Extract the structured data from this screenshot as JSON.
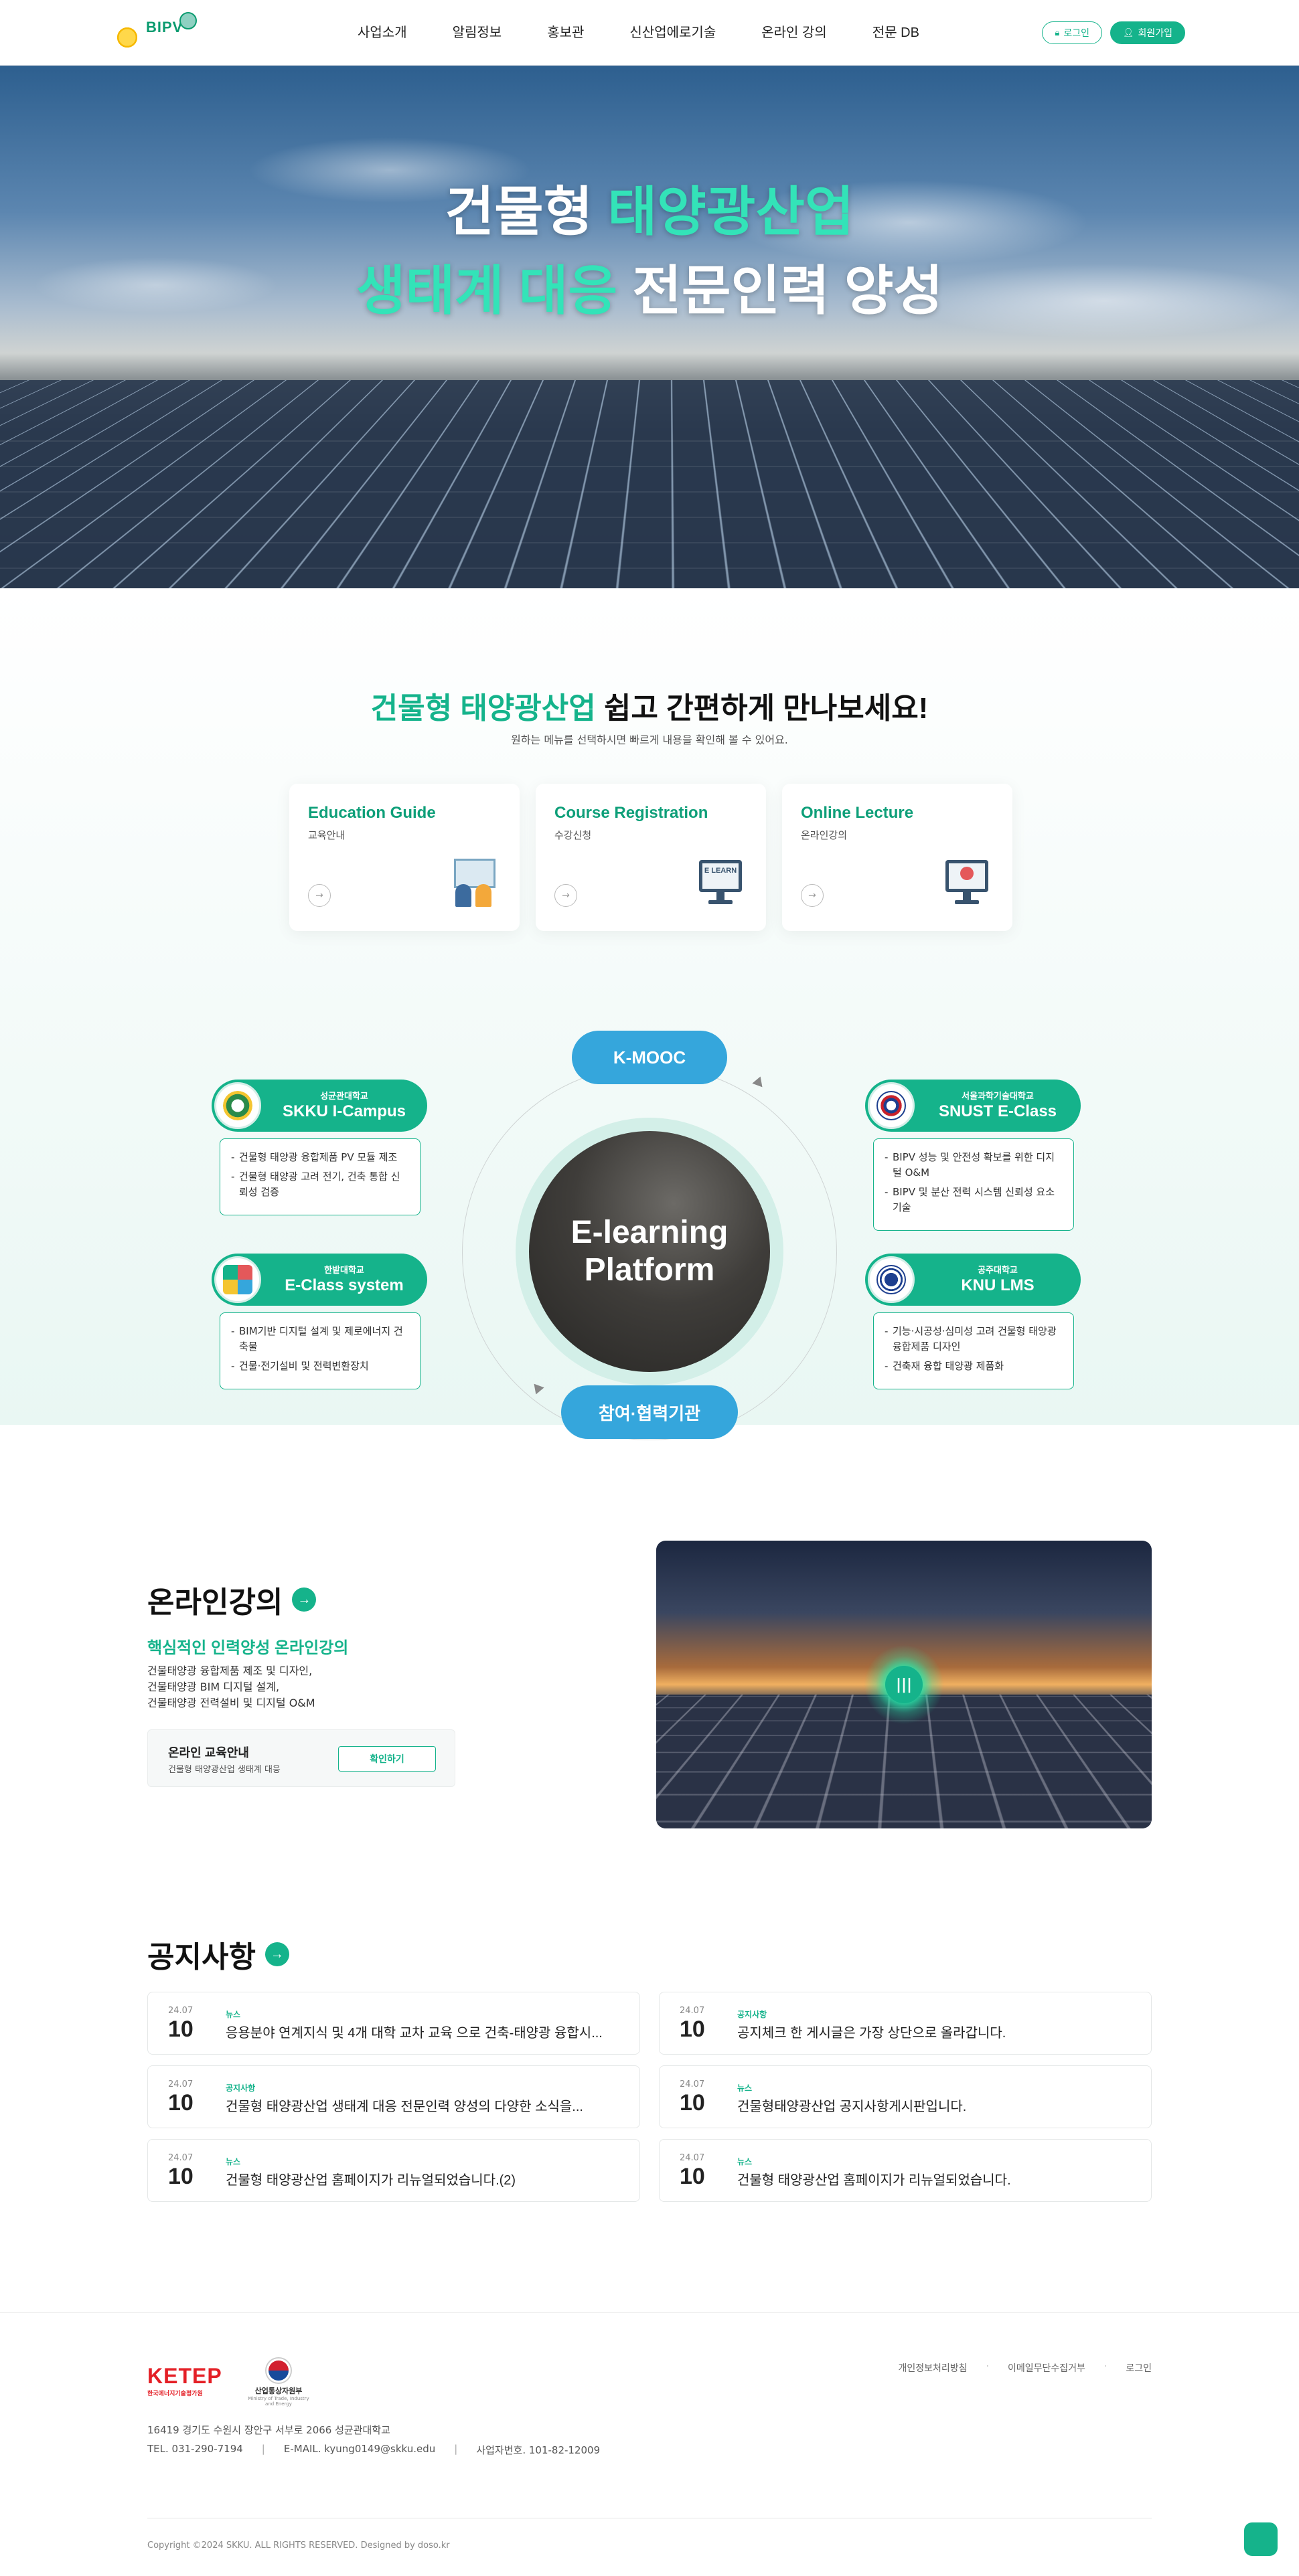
{
  "header": {
    "logo_text": "BIPV",
    "nav": [
      "사업소개",
      "알림정보",
      "홍보관",
      "신산업에로기술",
      "온라인 강의",
      "전문 DB"
    ],
    "login_label": "로그인",
    "signup_label": "회원가입"
  },
  "hero": {
    "line1_a": "건물형 ",
    "line1_b": "태양광산업",
    "line2_a": "생태계 대응",
    "line2_b": " 전문인력 양성"
  },
  "quick": {
    "title_green": "건물형 태양광산업",
    "title_rest": " 쉽고 간편하게 만나보세요!",
    "subtitle": "원하는 메뉴를 선택하시면 빠르게 내용을 확인해 볼 수 있어요.",
    "cards": [
      {
        "title": "Education Guide",
        "sub": "교육안내"
      },
      {
        "title": "Course Registration",
        "sub": "수강신청",
        "screen_text": "E LEARN"
      },
      {
        "title": "Online Lecture",
        "sub": "온라인강의"
      }
    ]
  },
  "diagram": {
    "center": "E-learning Platform",
    "top_tag": "K-MOOC",
    "bottom_tag": "참여·협력기관",
    "unis": [
      {
        "small": "성균관대학교",
        "name": "SKKU I-Campus",
        "items": [
          "건물형 태양광 융합제품 PV 모듈 제조",
          "건물형 태양광 고려 전기, 건축 통합 신뢰성 검증"
        ]
      },
      {
        "small": "한밭대학교",
        "name": "E-Class system",
        "items": [
          "BIM기반 디지털 설계 및 제로에너지 건축물",
          "건물·전기설비 및 전력변환장치"
        ]
      },
      {
        "small": "서울과학기술대학교",
        "name": "SNUST E-Class",
        "items": [
          "BIPV 성능 및 안전성 확보를 위한 디지털 O&M",
          "BIPV 및 분산 전력 시스템 신뢰성 요소기술"
        ]
      },
      {
        "small": "공주대학교",
        "name": "KNU LMS",
        "items": [
          "기능·시공성·심미성 고려 건물형 태양광 융합제품 디자인",
          "건축재 융합 태양광 제품화"
        ]
      }
    ]
  },
  "lecture": {
    "title": "온라인강의",
    "subtitle": "핵심적인 인력양성 온라인강의",
    "desc": [
      "건물태양광 융합제품 제조 및 디자인,",
      "건물태양광 BIM 디지털 설계,",
      "건물태양광 전력설비 및 디지털 O&M"
    ],
    "box_title": "온라인 교육안내",
    "box_sub": "건물형 태양광산업 생태계 대응",
    "box_button": "확인하기"
  },
  "notices": {
    "title": "공지사항",
    "items": [
      {
        "ym": "24.07",
        "day": "10",
        "cat": "뉴스",
        "title": "응용분야 연계지식 및 4개 대학 교차 교육 으로 건축-태양광 융합시..."
      },
      {
        "ym": "24.07",
        "day": "10",
        "cat": "공지사항",
        "title": "공지체크 한 게시글은 가장 상단으로 올라갑니다."
      },
      {
        "ym": "24.07",
        "day": "10",
        "cat": "공지사항",
        "title": "건물형 태양광산업 생태계 대응 전문인력 양성의 다양한 소식을..."
      },
      {
        "ym": "24.07",
        "day": "10",
        "cat": "뉴스",
        "title": "건물형태양광산업 공지사항게시판입니다."
      },
      {
        "ym": "24.07",
        "day": "10",
        "cat": "뉴스",
        "title": "건물형 태양광산업 홈페이지가 리뉴얼되었습니다.(2)"
      },
      {
        "ym": "24.07",
        "day": "10",
        "cat": "뉴스",
        "title": "건물형 태양광산업 홈페이지가 리뉴얼되었습니다."
      }
    ]
  },
  "footer": {
    "ketep": "KETEP",
    "ketep_sub": "한국에너지기술평가원",
    "motie": "산업통상자원부",
    "motie_en": "Ministry of Trade, Industry and Energy",
    "links": [
      "개인정보처리방침",
      "이메일무단수집거부",
      "로그인"
    ],
    "address": "16419 경기도 수원시 장안구 서부로 2066 성균관대학교",
    "tel": "TEL. 031-290-7194",
    "email": "E-MAIL. kyung0149@skku.edu",
    "bizno": "사업자번호. 101-82-12009",
    "copyright": "Copyright ©2024 SKKU. ALL RIGHTS RESERVED. Designed by doso.kr"
  },
  "colors": {
    "accent": "#15b38b",
    "blue_tag": "#35a6dc",
    "hero_highlight": "#33e3b8"
  }
}
